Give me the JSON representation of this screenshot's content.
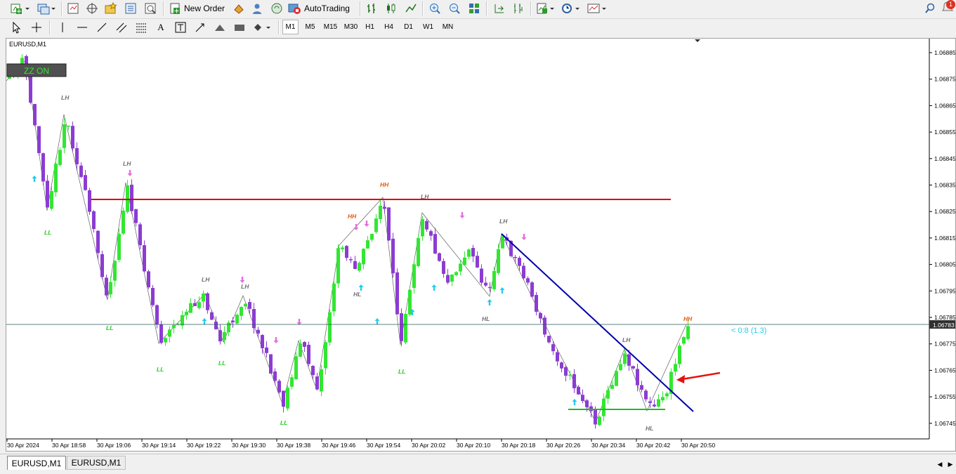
{
  "toolbar1": {
    "new_order_label": "New Order",
    "auto_trading_label": "AutoTrading",
    "notification_count": "1"
  },
  "timeframes": [
    "M1",
    "M5",
    "M15",
    "M30",
    "H1",
    "H4",
    "D1",
    "W1",
    "MN"
  ],
  "active_timeframe": "M1",
  "chart": {
    "symbol_label": "EURUSD,M1",
    "zz_button_label": "ZZ ON",
    "current_price": "1.06783",
    "countdown_label": "< 0:8 (1.3)",
    "price_ticks": [
      "1.06885",
      "1.06875",
      "1.06865",
      "1.06855",
      "1.06845",
      "1.06835",
      "1.06825",
      "1.06815",
      "1.06805",
      "1.06795",
      "1.06785",
      "1.06775",
      "1.06765",
      "1.06755",
      "1.06745"
    ],
    "time_ticks": [
      "30 Apr 2024",
      "30 Apr 18:58",
      "30 Apr 19:06",
      "30 Apr 19:14",
      "30 Apr 19:22",
      "30 Apr 19:30",
      "30 Apr 19:38",
      "30 Apr 19:46",
      "30 Apr 19:54",
      "30 Apr 20:02",
      "30 Apr 20:10",
      "30 Apr 20:18",
      "30 Apr 20:26",
      "30 Apr 20:34",
      "30 Apr 20:42",
      "30 Apr 20:50"
    ],
    "labels": [
      {
        "t": "LH",
        "c": "#707070"
      },
      {
        "t": "LL",
        "c": "#22cc22"
      },
      {
        "t": "LH",
        "c": "#707070"
      },
      {
        "t": "LL",
        "c": "#22cc22"
      },
      {
        "t": "LL",
        "c": "#22cc22"
      },
      {
        "t": "LH",
        "c": "#707070"
      },
      {
        "t": "LL",
        "c": "#22cc22"
      },
      {
        "t": "LH",
        "c": "#707070"
      },
      {
        "t": "LL",
        "c": "#22cc22"
      },
      {
        "t": "HH",
        "c": "#e05a10"
      },
      {
        "t": "HL",
        "c": "#707070"
      },
      {
        "t": "HH",
        "c": "#e05a10"
      },
      {
        "t": "LL",
        "c": "#22cc22"
      },
      {
        "t": "LH",
        "c": "#707070"
      },
      {
        "t": "HL",
        "c": "#707070"
      },
      {
        "t": "LH",
        "c": "#707070"
      },
      {
        "t": "LH",
        "c": "#707070"
      },
      {
        "t": "HL",
        "c": "#707070"
      },
      {
        "t": "HH",
        "c": "#e05a10"
      }
    ],
    "colors": {
      "bull": "#32e632",
      "bear": "#8c3cd2",
      "resistance": "#dd0000",
      "trendline": "#0000aa",
      "support": "#22bb22",
      "arrow": "#e81010",
      "up_arrow": "#22ccee",
      "down_arrow": "#e070e0"
    }
  },
  "tabs": [
    "EURUSD,M1",
    "EURUSD,M1"
  ]
}
